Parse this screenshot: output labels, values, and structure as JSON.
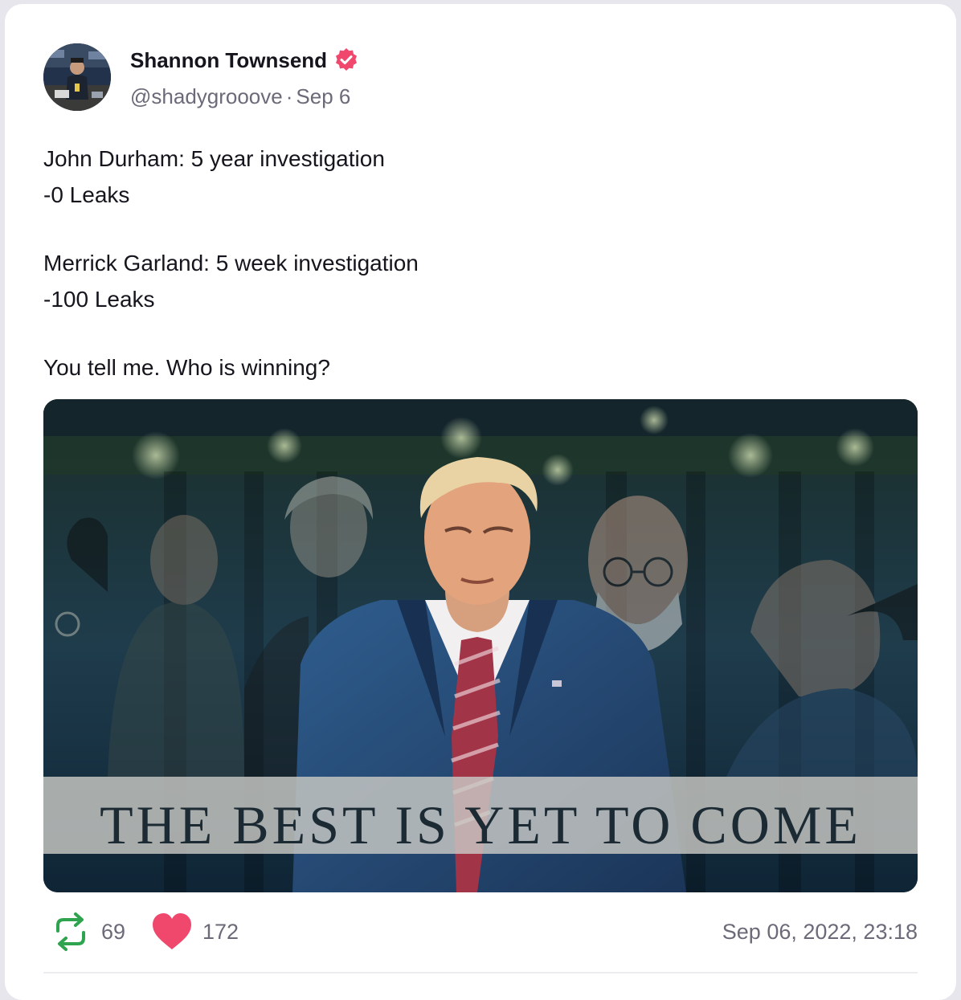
{
  "post": {
    "author": {
      "display_name": "Shannon Townsend",
      "handle": "@shadygrooove",
      "separator": "·",
      "date": "Sep 6",
      "verified": true,
      "avatar_icon": "avatar-photo"
    },
    "text_lines": [
      "John Durham: 5 year investigation",
      "-0 Leaks",
      "",
      "Merrick Garland: 5 week investigation",
      "-100 Leaks",
      "",
      "You tell me. Who is winning?"
    ],
    "media": {
      "caption_text": "THE BEST IS YET TO COME"
    },
    "stats": {
      "reposts": "69",
      "likes": "172",
      "repost_icon": "repost-icon",
      "like_icon": "heart-icon"
    },
    "timestamp": "Sep 06, 2022, 23:18"
  },
  "colors": {
    "verified_badge": "#f0476d",
    "repost_icon": "#2ea44f",
    "like_icon": "#f0476d",
    "secondary_text": "#6b6a78",
    "primary_text": "#16151d"
  }
}
